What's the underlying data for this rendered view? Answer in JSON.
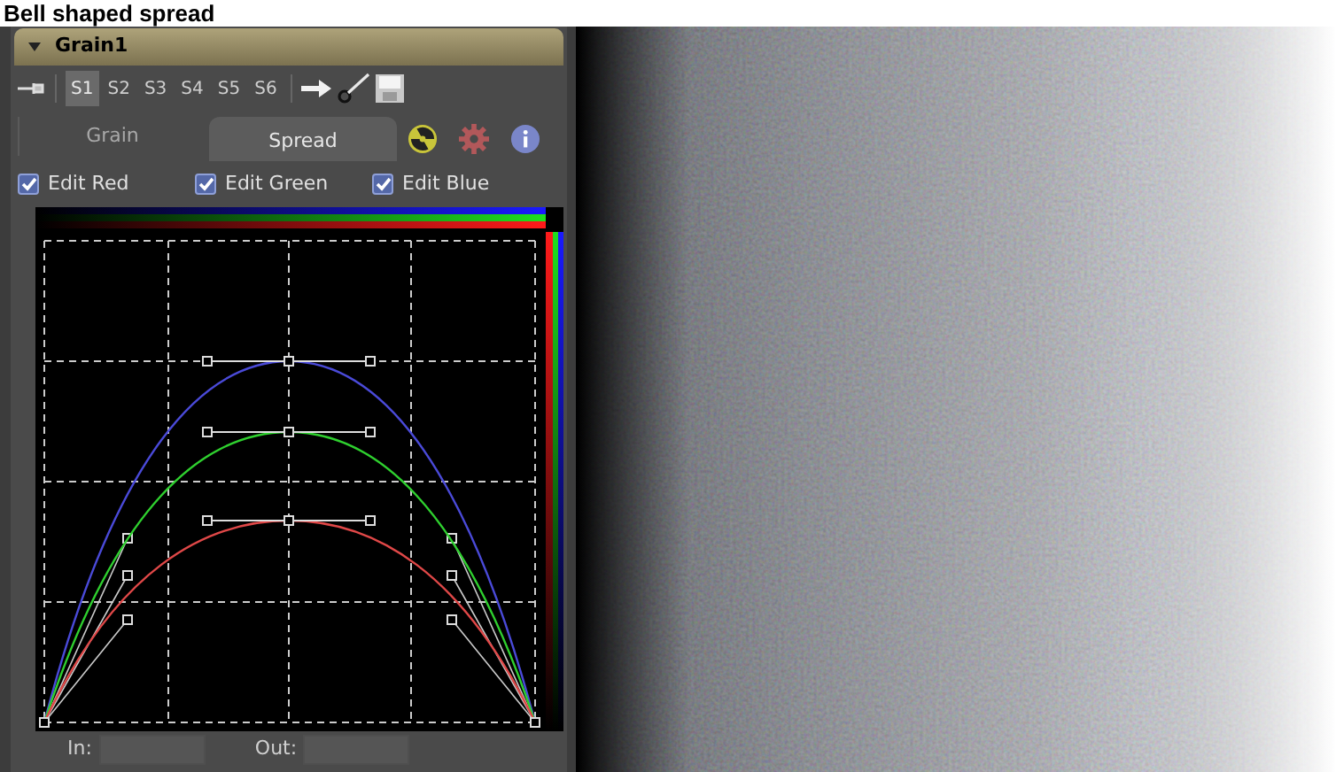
{
  "title": "Bell shaped spread",
  "panel": {
    "header": {
      "title": "Grain1",
      "expanded": true
    },
    "slots": [
      {
        "label": "S1",
        "selected": true
      },
      {
        "label": "S2",
        "selected": false
      },
      {
        "label": "S3",
        "selected": false
      },
      {
        "label": "S4",
        "selected": false
      },
      {
        "label": "S5",
        "selected": false
      },
      {
        "label": "S6",
        "selected": false
      }
    ],
    "tabs": [
      {
        "label": "Grain",
        "selected": false
      },
      {
        "label": "Spread",
        "selected": true
      }
    ],
    "channels": [
      {
        "label": "Edit Red",
        "checked": true
      },
      {
        "label": "Edit Green",
        "checked": true
      },
      {
        "label": "Edit Blue",
        "checked": true
      }
    ],
    "fields": [
      {
        "label": "In:"
      },
      {
        "label": "Out:"
      }
    ]
  }
}
